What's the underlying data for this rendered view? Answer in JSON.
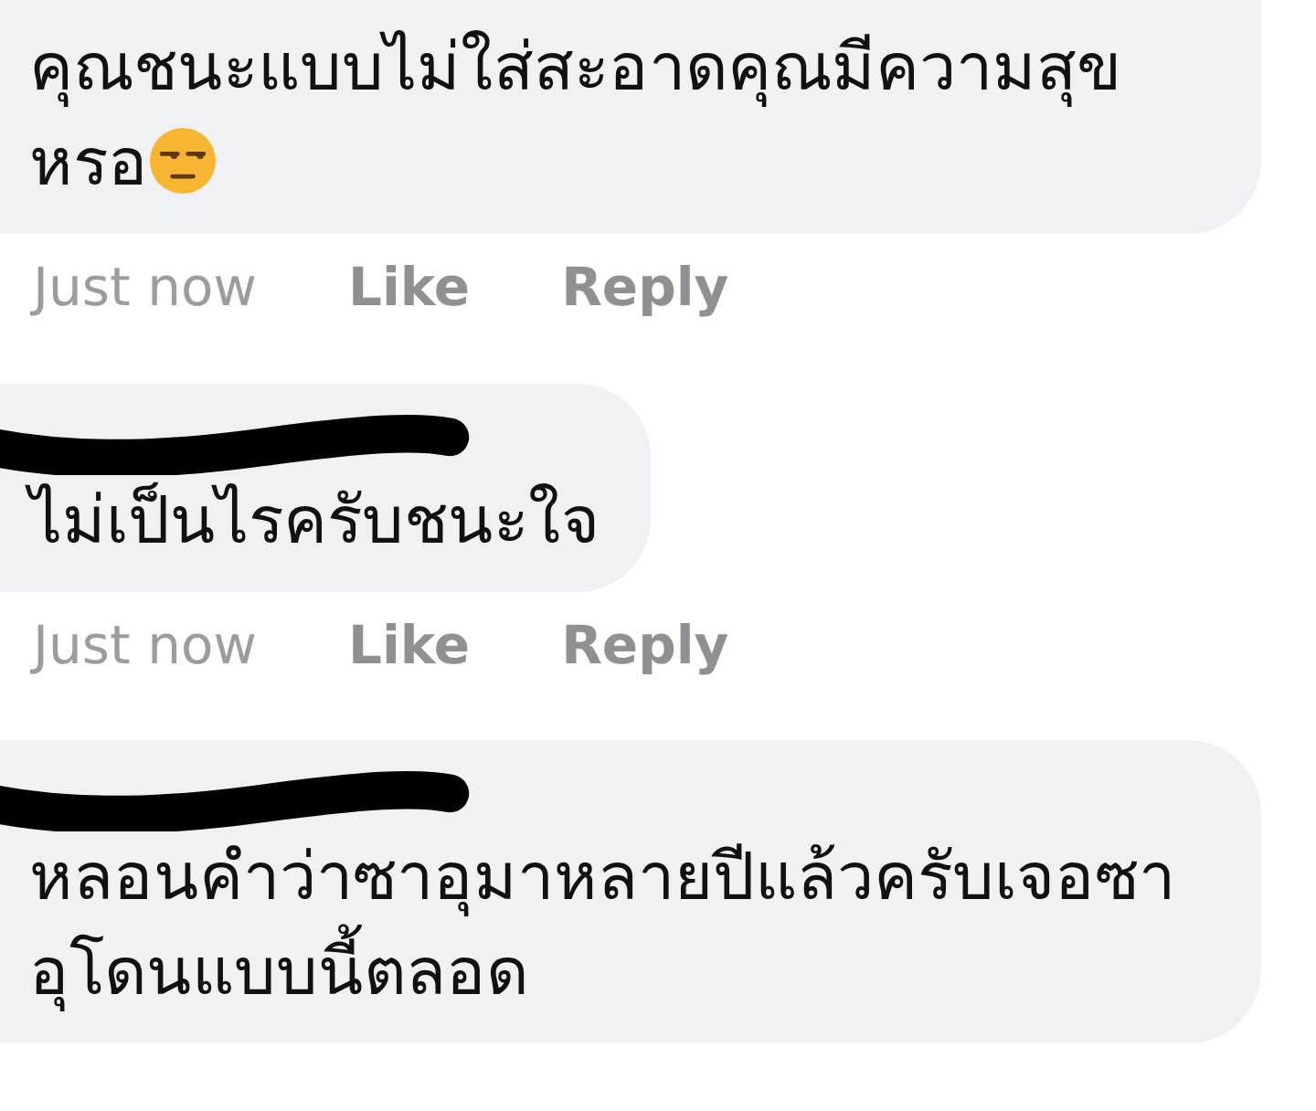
{
  "comments": [
    {
      "name_redacted": false,
      "text": "คุณชนะแบบไม่ใส่สะอาดคุณมีความสุขหรอ",
      "trailing_emoji": true,
      "time": "Just now",
      "like": "Like",
      "reply": "Reply"
    },
    {
      "name_redacted": true,
      "text": "ไม่เป็นไรครับชนะใจ",
      "trailing_emoji": false,
      "time": "Just now",
      "like": "Like",
      "reply": "Reply"
    },
    {
      "name_redacted": true,
      "text": "หลอนคำว่าซาอุมาหลายปีแล้วครับเจอซาอุโดนแบบนี้ตลอด",
      "trailing_emoji": false
    }
  ]
}
